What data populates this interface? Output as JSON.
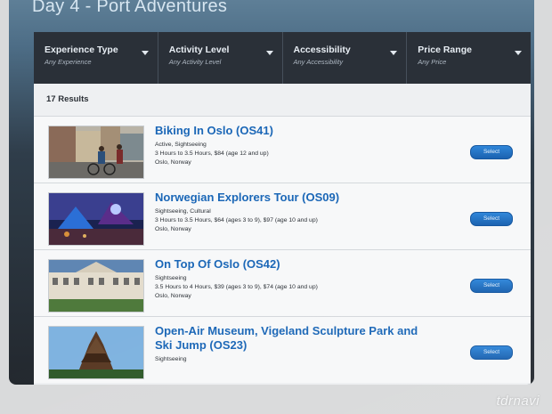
{
  "page": {
    "title": "Day 4 - Port Adventures"
  },
  "filters": [
    {
      "label": "Experience Type",
      "value": "Any Experience"
    },
    {
      "label": "Activity Level",
      "value": "Any Activity Level"
    },
    {
      "label": "Accessibility",
      "value": "Any Accessibility"
    },
    {
      "label": "Price Range",
      "value": "Any Price"
    }
  ],
  "results": {
    "count_label": "17 Results",
    "items": [
      {
        "title": "Biking In Oslo (OS41)",
        "category": "Active, Sightseeing",
        "details": "3 Hours to 3.5 Hours, $84 (age 12 and up)",
        "location": "Oslo, Norway",
        "select_label": "Select"
      },
      {
        "title": "Norwegian Explorers Tour (OS09)",
        "category": "Sightseeing, Cultural",
        "details": "3 Hours to 3.5 Hours, $64 (ages 3 to 9), $97 (age 10 and up)",
        "location": "Oslo, Norway",
        "select_label": "Select"
      },
      {
        "title": "On Top Of Oslo (OS42)",
        "category": "Sightseeing",
        "details": "3.5 Hours to 4 Hours, $39 (ages 3 to 9), $74 (age 10 and up)",
        "location": "Oslo, Norway",
        "select_label": "Select"
      },
      {
        "title": "Open-Air Museum, Vigeland Sculpture Park and Ski Jump (OS23)",
        "category": "Sightseeing",
        "details": "",
        "location": "",
        "select_label": "Select"
      }
    ]
  },
  "watermark": "tdrnavi",
  "colors": {
    "accent": "#1b67b7",
    "filterbar": "#2a3038",
    "button": "#2275c8"
  }
}
